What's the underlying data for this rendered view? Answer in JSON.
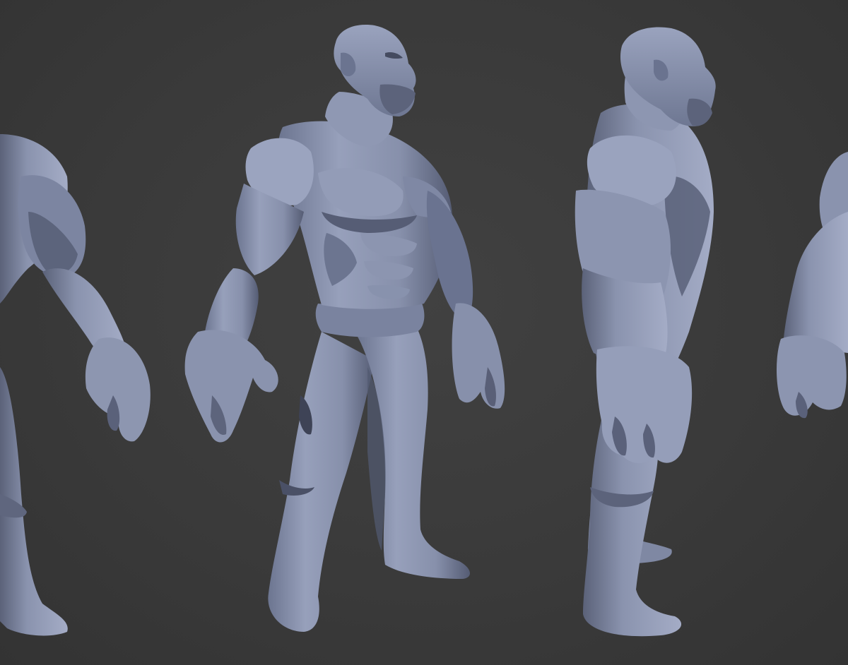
{
  "scene": {
    "background_color": "#3a3a3a",
    "model_color": "#8a93ad",
    "model_shadow_color": "#4b5168",
    "model_highlight_color": "#b7bfd6",
    "views": [
      {
        "id": "view-back-left",
        "angle": "three-quarter-back",
        "cropped": "left"
      },
      {
        "id": "view-front-three-quarter",
        "angle": "three-quarter-front",
        "cropped": "none"
      },
      {
        "id": "view-side",
        "angle": "right-profile",
        "cropped": "none"
      },
      {
        "id": "view-back-right",
        "angle": "three-quarter-back",
        "cropped": "right"
      }
    ]
  }
}
